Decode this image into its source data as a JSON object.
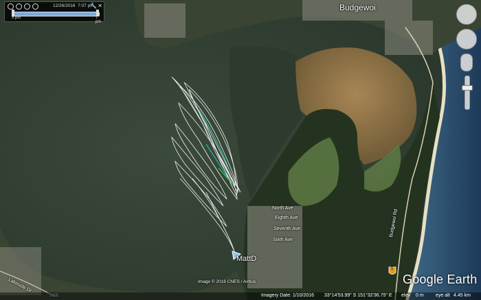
{
  "map": {
    "place_labels": {
      "budgewoi": "Budgewoi",
      "mattd": "MattD",
      "north_ave": "North Ave",
      "eighth_ave": "Eighth Ave",
      "seventh_ave": "Seventh Ave",
      "sixth_ave": "Sixth Ave",
      "budgewoi_rd": "Budgewoi Rd",
      "road_sign": "5",
      "lakeside": "Lakeside Dr",
      "bottom_road": "2005",
      "imagery_credit": "Image © 2016 CNES / Airbus"
    }
  },
  "timebar": {
    "date": "12/26/2016",
    "time": "7:07 pm",
    "start_label": "5 pm",
    "end_label": "7 pm"
  },
  "status": {
    "imagery_date": "Imagery Date: 1/10/2016",
    "coords": "33°14'53.99\" S 151°32'36.75\" E",
    "elev_label": "elev",
    "elev": "0 m",
    "eye_alt": "eye alt",
    "eye_alt_value": "4.45 km"
  },
  "brand": {
    "google_earth": "Google Earth"
  },
  "colors": {
    "track": "#ffffff",
    "track_accent": "#2ec9b3",
    "track_green": "#3fd24a"
  }
}
